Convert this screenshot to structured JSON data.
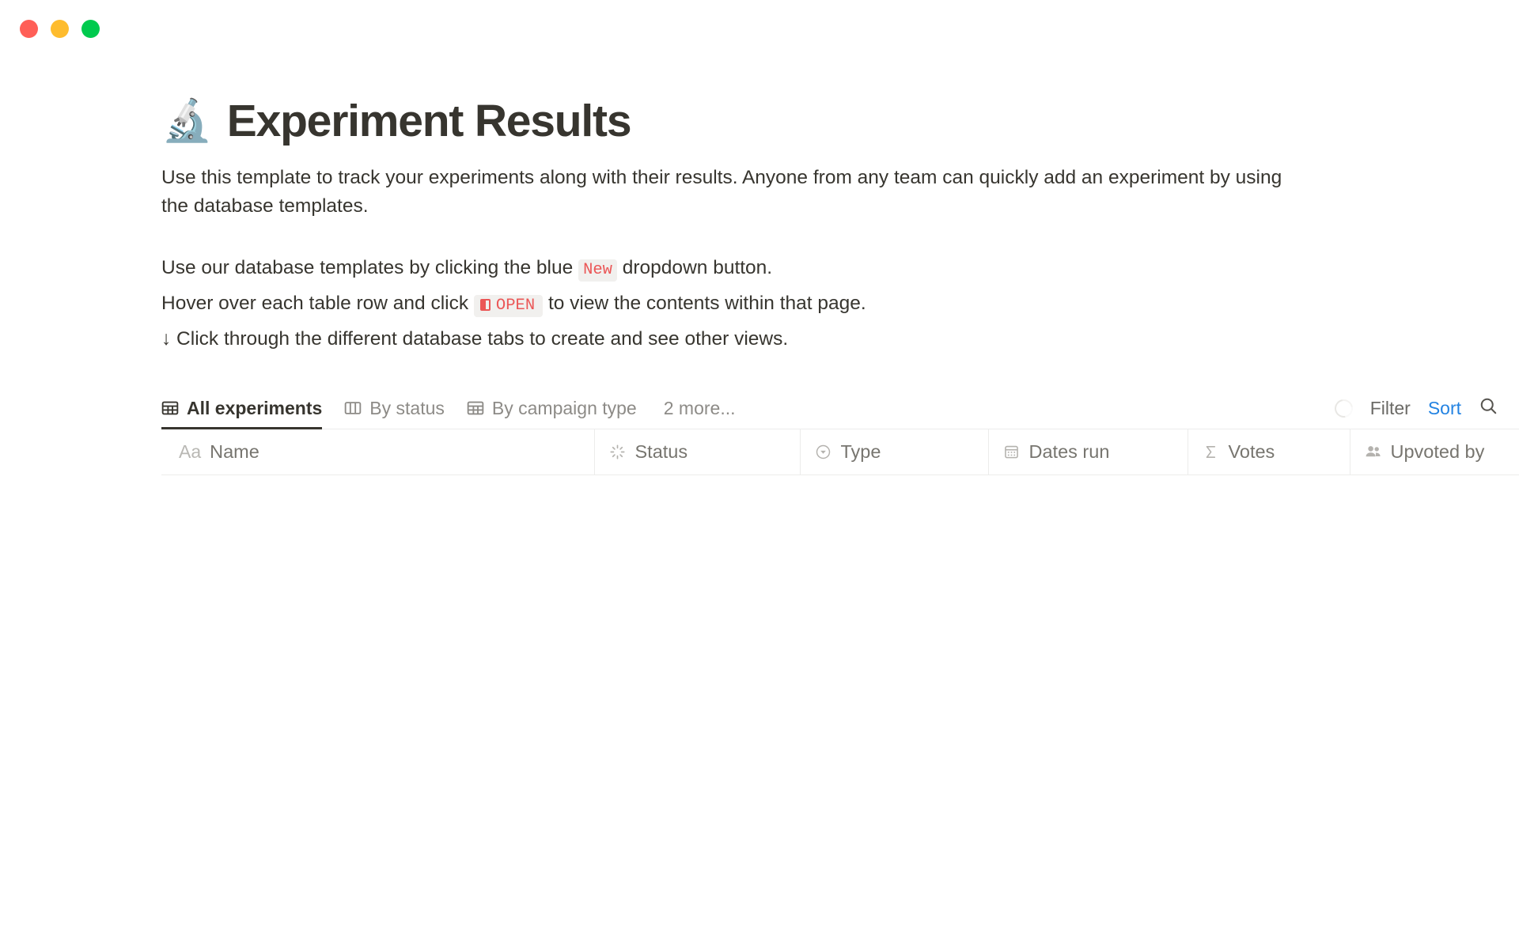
{
  "window": {
    "traffic_lights": [
      {
        "name": "close",
        "color": "#ff5f57"
      },
      {
        "name": "minimize",
        "color": "#febc2e"
      },
      {
        "name": "maximize",
        "color": "#00ca4e"
      }
    ]
  },
  "page": {
    "emoji": "🔬",
    "emoji_name": "microscope",
    "title": "Experiment Results",
    "paragraph_1": "Use this template to track your experiments along with their results. Anyone from any team can quickly add an experiment by using the database templates.",
    "line_2_before": "Use our database templates by clicking the blue ",
    "line_2_code": "New",
    "line_2_after": " dropdown button.",
    "line_3_before": "Hover over each table row and click ",
    "line_3_code": "OPEN",
    "line_3_after": " to view the contents within that page.",
    "line_4": "↓ Click through the different database tabs to create and see other views."
  },
  "database": {
    "tabs": [
      {
        "label": "All experiments",
        "icon": "table-icon",
        "active": true
      },
      {
        "label": "By status",
        "icon": "board-icon",
        "active": false
      },
      {
        "label": "By campaign type",
        "icon": "table-icon",
        "active": false
      }
    ],
    "more_tabs_label": "2 more...",
    "toolbar": {
      "loading_icon": "spinner-icon",
      "filter_label": "Filter",
      "sort_label": "Sort",
      "sort_color": "#2383e2",
      "search_icon": "search-icon"
    },
    "columns": [
      {
        "label": "Name",
        "icon": "text-aa-icon",
        "type_prefix": "Aa"
      },
      {
        "label": "Status",
        "icon": "status-spinner-icon"
      },
      {
        "label": "Type",
        "icon": "select-chevron-icon"
      },
      {
        "label": "Dates run",
        "icon": "calendar-icon"
      },
      {
        "label": "Votes",
        "icon": "sigma-icon"
      },
      {
        "label": "Upvoted by",
        "icon": "people-icon"
      }
    ],
    "rows": []
  }
}
